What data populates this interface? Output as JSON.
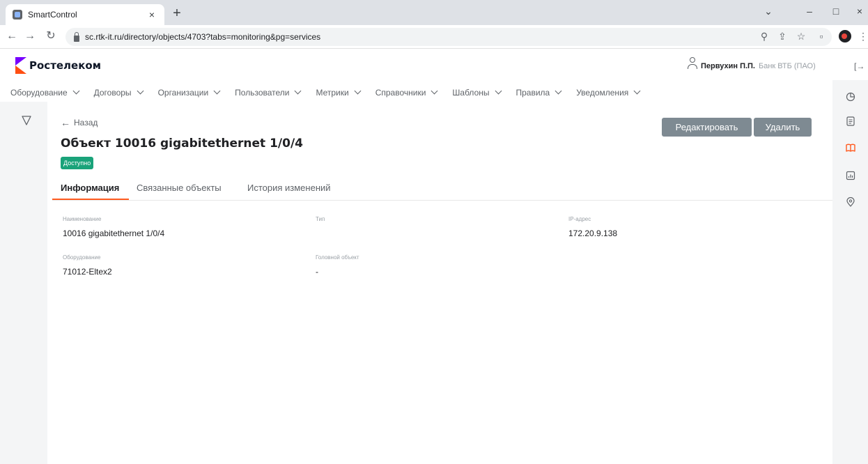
{
  "browser": {
    "tab_title": "SmartControl",
    "tab_close": "×",
    "new_tab": "+",
    "url": "sc.rtk-it.ru/directory/objects/4703?tabs=monitoring&pg=services"
  },
  "header": {
    "logo_text": "Ростелеком",
    "user_name": "Первухин П.П.",
    "user_org": "Банк ВТБ (ПАО)",
    "logout_glyph": "[→"
  },
  "menu": {
    "items": [
      {
        "label": "Оборудование"
      },
      {
        "label": "Договоры"
      },
      {
        "label": "Организации"
      },
      {
        "label": "Пользователи"
      },
      {
        "label": "Метрики"
      },
      {
        "label": "Справочники"
      },
      {
        "label": "Шаблоны"
      },
      {
        "label": "Правила"
      },
      {
        "label": "Уведомления"
      }
    ]
  },
  "page": {
    "back_label": "Назад",
    "title": "Объект 10016 gigabitethernet 1/0/4",
    "status": "Доступно",
    "status_color": "#1aa37a",
    "edit_label": "Редактировать",
    "delete_label": "Удалить"
  },
  "tabs": [
    {
      "label": "Информация",
      "active": true
    },
    {
      "label": "Связанные объекты",
      "active": false
    },
    {
      "label": "История изменений",
      "active": false
    }
  ],
  "fields": {
    "name_label": "Наименование",
    "name_value": "10016 gigabitethernet 1/0/4",
    "type_label": "Тип",
    "type_value": "",
    "ip_label": "IP-адрес",
    "ip_value": "172.20.9.138",
    "equipment_label": "Оборудование",
    "equipment_value": "71012-Eltex2",
    "head_label": "Головной объект",
    "head_value": "-"
  },
  "colors": {
    "accent": "#ff5a1f",
    "brand_purple": "#7700ff",
    "button_gray": "#7e8a92"
  }
}
